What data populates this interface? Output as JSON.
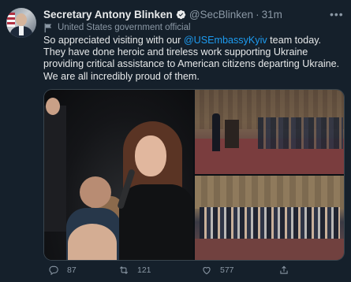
{
  "tweet": {
    "author_name": "Secretary Antony Blinken",
    "handle": "@SecBlinken",
    "separator": "·",
    "time": "31m",
    "label": "United States government official",
    "text_before": "So appreciated visiting with our ",
    "mention": "@USEmbassyKyiv",
    "text_after": " team today. They have done heroic and tireless work supporting Ukraine providing critical assistance to American citizens departing Ukraine. We are all incredibly proud of them."
  },
  "actions": {
    "replies": "87",
    "retweets": "121",
    "likes": "577"
  },
  "icons": {
    "verified": "verified-badge-icon",
    "label": "government-flag-icon",
    "reply": "reply-icon",
    "retweet": "retweet-icon",
    "like": "heart-icon",
    "share": "share-icon",
    "more": "more-icon"
  },
  "colors": {
    "background": "#15202b",
    "text": "#e7e9ea",
    "secondary": "#8b98a5",
    "accent": "#1d9bf0"
  }
}
